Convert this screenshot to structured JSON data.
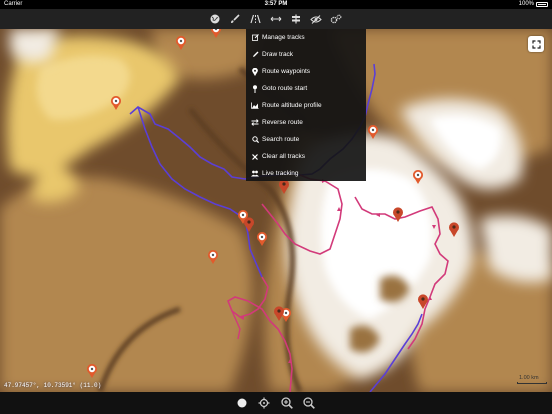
{
  "status_bar": {
    "carrier": "Carrier",
    "time": "3:57 PM",
    "battery": "100%"
  },
  "toolbar": {
    "buttons": [
      {
        "name": "globe-icon"
      },
      {
        "name": "brush-icon"
      },
      {
        "name": "road-icon"
      },
      {
        "name": "measure-icon"
      },
      {
        "name": "signpost-icon"
      },
      {
        "name": "eye-slash-icon"
      },
      {
        "name": "settings-icon"
      }
    ]
  },
  "menu": {
    "items": [
      {
        "label": "Manage tracks",
        "icon": "edit-icon"
      },
      {
        "label": "Draw track",
        "icon": "pencil-icon"
      },
      {
        "label": "Route waypoints",
        "icon": "map-marker-icon"
      },
      {
        "label": "Goto route start",
        "icon": "pin-icon"
      },
      {
        "label": "Route altitude profile",
        "icon": "area-chart-icon"
      },
      {
        "label": "Reverse route",
        "icon": "swap-icon"
      },
      {
        "label": "Search route",
        "icon": "search-icon"
      },
      {
        "label": "Clear all tracks",
        "icon": "close-icon"
      },
      {
        "label": "Live tracking",
        "icon": "users-icon"
      }
    ]
  },
  "map": {
    "coordinates": "47.97457°, 10.73591° (11.0)",
    "scale": "1.00 km",
    "colors": {
      "low": "#6b4a2a",
      "mid": "#b0874f",
      "yellow": "#e7c56a",
      "high": "#ffffff",
      "track_blue": "#5b3fd6",
      "track_red": "#d23a7a",
      "marker_orange": "#e25a2c",
      "marker_red": "#d24a2c"
    }
  },
  "bottom_bar": {
    "buttons": [
      "record-dot-icon",
      "crosshair-icon",
      "zoom-in-icon",
      "zoom-out-icon"
    ]
  }
}
